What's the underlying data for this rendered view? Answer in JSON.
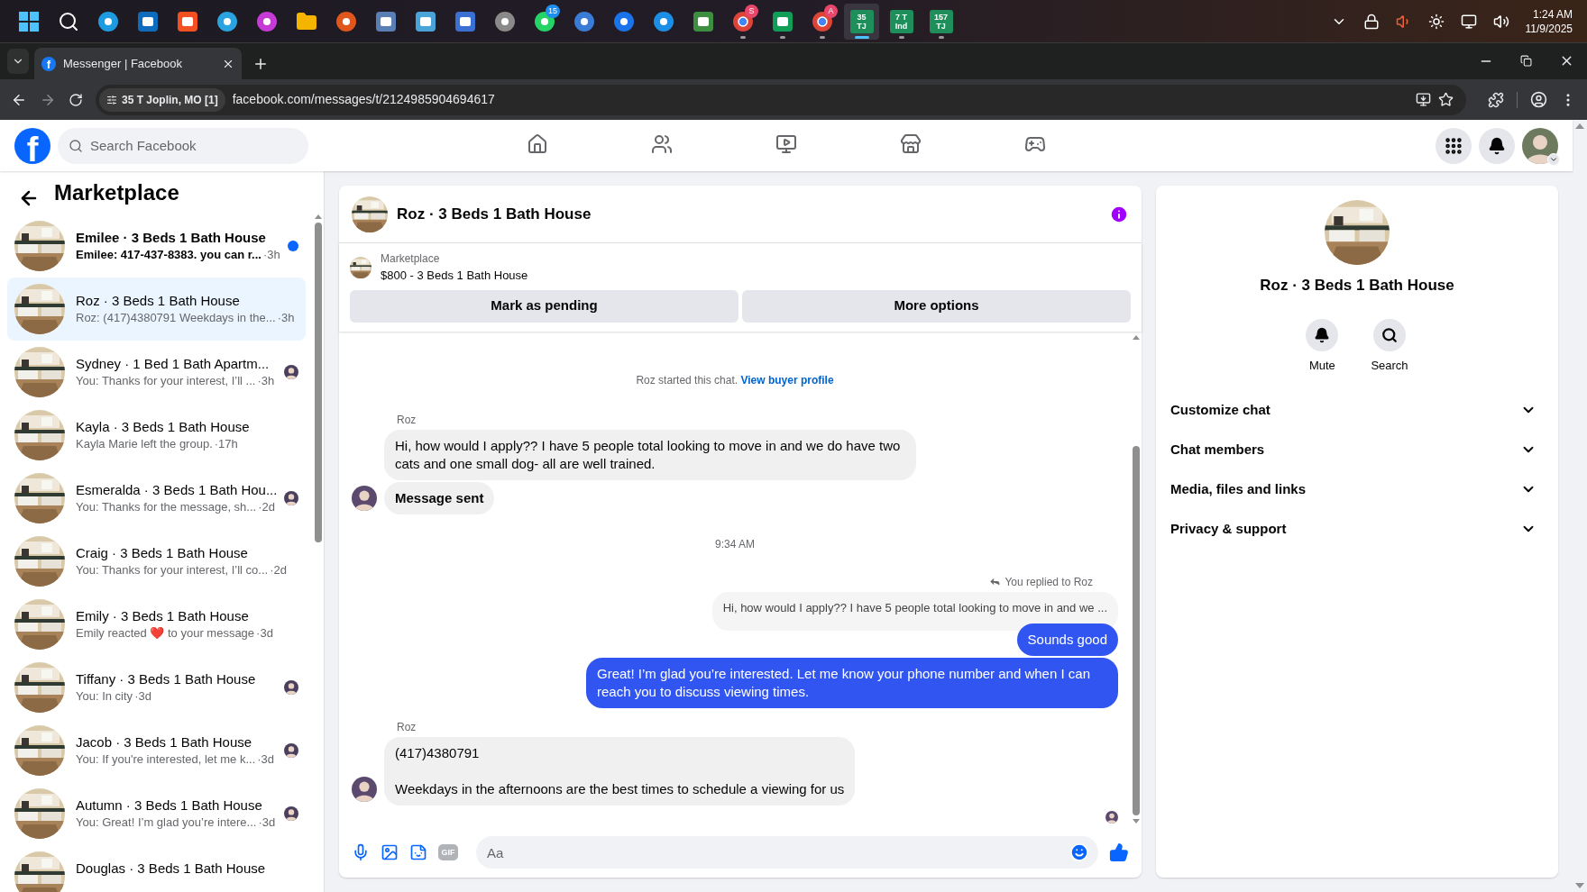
{
  "taskbar": {
    "apps": [
      {
        "kind": "windows",
        "running": false,
        "active": false
      },
      {
        "kind": "search",
        "running": false,
        "active": false
      },
      {
        "kind": "circle",
        "color": "#1e9be0",
        "running": false,
        "active": false
      },
      {
        "kind": "square",
        "color": "#0f6cbd",
        "running": false,
        "active": false
      },
      {
        "kind": "square",
        "color": "#f25022",
        "running": false,
        "active": false
      },
      {
        "kind": "circle",
        "color": "#2aa3e0",
        "running": false,
        "active": false
      },
      {
        "kind": "circle",
        "color": "#c63bd6",
        "running": false,
        "active": false
      },
      {
        "kind": "folder",
        "color": "#f4b400",
        "running": false,
        "active": false
      },
      {
        "kind": "circle",
        "color": "#e0561b",
        "running": false,
        "active": false
      },
      {
        "kind": "square",
        "color": "#5a7fb5",
        "running": false,
        "active": false
      },
      {
        "kind": "square",
        "color": "#4aa3d8",
        "running": false,
        "active": false
      },
      {
        "kind": "square",
        "color": "#3b6fd1",
        "running": false,
        "active": false
      },
      {
        "kind": "circle",
        "color": "#8a8a8a",
        "running": false,
        "active": false
      },
      {
        "kind": "circle",
        "color": "#25d366",
        "badge": "15",
        "running": false,
        "active": false
      },
      {
        "kind": "circle",
        "color": "#3a7bd5",
        "running": false,
        "active": false
      },
      {
        "kind": "circle",
        "color": "#1a73e8",
        "running": false,
        "active": false
      },
      {
        "kind": "circle",
        "color": "#1d8ee6",
        "running": false,
        "active": false
      },
      {
        "kind": "square",
        "color": "#3e8e41",
        "running": false,
        "active": false
      },
      {
        "kind": "ring",
        "color": "#db4437",
        "badge": "S",
        "running": true,
        "active": false
      },
      {
        "kind": "square",
        "color": "#0f9d58",
        "running": true,
        "active": false
      },
      {
        "kind": "ring",
        "color": "#db4437",
        "badge": "A",
        "running": true,
        "active": false
      },
      {
        "kind": "tile",
        "color": "#1e8e5a",
        "lines": [
          "35",
          "TJ"
        ],
        "running": true,
        "active": true
      },
      {
        "kind": "tile",
        "color": "#1e8e5a",
        "lines": [
          "7 T",
          "Ind"
        ],
        "running": true,
        "active": false
      },
      {
        "kind": "tile",
        "color": "#1e8e5a",
        "lines": [
          "157",
          "TJ"
        ],
        "running": true,
        "active": false
      }
    ],
    "time": "1:24 AM",
    "date": "11/9/2025"
  },
  "browser": {
    "tab": {
      "favicon": "f",
      "title": "Messenger | Facebook"
    },
    "site_info": "35 T Joplin, MO [1]",
    "url": "facebook.com/messages/t/2124985904694617"
  },
  "facebook": {
    "logo": "f",
    "search": {
      "placeholder": "Search Facebook"
    },
    "nav": [
      {
        "kind": "home",
        "selected": false
      },
      {
        "kind": "friends",
        "selected": false
      },
      {
        "kind": "video",
        "selected": false
      },
      {
        "kind": "marketplace",
        "selected": false
      },
      {
        "kind": "gaming",
        "selected": false
      }
    ]
  },
  "sidebar": {
    "title": "Marketplace",
    "conversations": [
      {
        "name": "Emilee · 3 Beds 1 Bath House",
        "preview": "Emilee: 417-437-8383. you can r...",
        "time": "·3h",
        "unread": true,
        "selected": false,
        "seen_avatar": false
      },
      {
        "name": "Roz · 3 Beds 1 Bath House",
        "preview": "Roz: (417)4380791 Weekdays in the...",
        "time": "·3h",
        "unread": false,
        "selected": true,
        "seen_avatar": false
      },
      {
        "name": "Sydney · 1 Bed 1 Bath Apartm...",
        "preview": "You: Thanks for your interest, I’ll ...",
        "time": "·3h",
        "unread": false,
        "selected": false,
        "seen_avatar": true
      },
      {
        "name": "Kayla · 3 Beds 1 Bath House",
        "preview": "Kayla Marie left the group.",
        "time": "·17h",
        "unread": false,
        "selected": false,
        "seen_avatar": false
      },
      {
        "name": "Esmeralda · 3 Beds 1 Bath Hou...",
        "preview": "You: Thanks for the message, sh...",
        "time": "·2d",
        "unread": false,
        "selected": false,
        "seen_avatar": true
      },
      {
        "name": "Craig · 3 Beds 1 Bath House",
        "preview": "You: Thanks for your interest, I’ll co...",
        "time": "·2d",
        "unread": false,
        "selected": false,
        "seen_avatar": false
      },
      {
        "name": "Emily · 3 Beds 1 Bath House",
        "preview": "Emily reacted ❤️ to your message",
        "time": "·3d",
        "unread": false,
        "selected": false,
        "seen_avatar": false
      },
      {
        "name": "Tiffany · 3 Beds 1 Bath House",
        "preview": "You: In city",
        "time": "·3d",
        "unread": false,
        "selected": false,
        "seen_avatar": true
      },
      {
        "name": "Jacob · 3 Beds 1 Bath House",
        "preview": "You: If you're interested, let me k...",
        "time": "·3d",
        "unread": false,
        "selected": false,
        "seen_avatar": true
      },
      {
        "name": "Autumn · 3 Beds 1 Bath House",
        "preview": "You: Great! I’m glad you’re intere...",
        "time": "·3d",
        "unread": false,
        "selected": false,
        "seen_avatar": true
      },
      {
        "name": "Douglas · 3 Beds 1 Bath House",
        "unread": false,
        "selected": false,
        "seen_avatar": false
      }
    ]
  },
  "chat": {
    "title": "Roz · 3 Beds 1 Bath House",
    "listing": {
      "source": "Marketplace",
      "title": "$800 - 3 Beds 1 Bath House"
    },
    "actions": [
      "Mark as pending",
      "More options"
    ],
    "messages": [
      {
        "kind": "notice",
        "text": "Roz started this chat.",
        "link": "View buyer profile"
      },
      {
        "kind": "incoming",
        "sender": "Roz",
        "bubbles": [
          {
            "text": "Hi, how would I apply?? I have 5 people total looking to move in and we do have two cats and one small dog- all are well trained.",
            "bold": false
          },
          {
            "text": "Message sent",
            "bold": true
          }
        ]
      },
      {
        "kind": "time",
        "text": "9:34 AM"
      },
      {
        "kind": "outgoing",
        "reply_note": "You replied to Roz",
        "quote": "Hi, how would I apply?? I have 5 people total looking to move in and we ...",
        "bubbles": [
          "Sounds good",
          "Great! I’m glad you’re interested. Let me know your phone number and when I can reach you to discuss viewing times."
        ]
      },
      {
        "kind": "incoming",
        "sender": "Roz",
        "bubbles": [
          {
            "text": "(417)4380791\n\nWeekdays in the afternoons are the best times to schedule a viewing for us",
            "bold": false
          }
        ]
      }
    ],
    "composer": {
      "placeholder": "Aa",
      "gif": "GIF"
    }
  },
  "details": {
    "title": "Roz · 3 Beds 1 Bath House",
    "buttons": [
      {
        "kind": "mute",
        "label": "Mute"
      },
      {
        "kind": "search",
        "label": "Search"
      }
    ],
    "sections": [
      {
        "label": "Customize chat",
        "expanded": false
      },
      {
        "label": "Chat members",
        "expanded": false
      },
      {
        "label": "Media, files and links",
        "expanded": false
      },
      {
        "label": "Privacy & support",
        "expanded": false
      }
    ]
  }
}
